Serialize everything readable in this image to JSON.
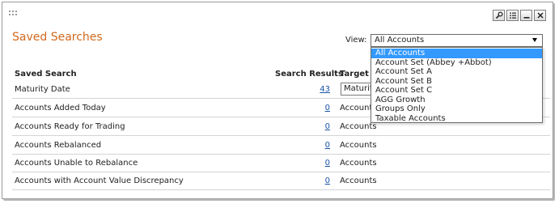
{
  "panel": {
    "title": "Saved Searches"
  },
  "toolbar": {
    "icons": [
      "wrench-icon",
      "list-settings-icon",
      "minimize-icon",
      "close-icon"
    ]
  },
  "view": {
    "label": "View:",
    "selected": "All Accounts",
    "options": [
      "All Accounts",
      "Account Set (Abbey +Abbot)",
      "Account Set A",
      "Account Set B",
      "Account Set C",
      "AGG Growth",
      "Groups Only",
      "Taxable Accounts"
    ]
  },
  "columns": {
    "saved_search": "Saved Search",
    "search_results": "Search Results",
    "target": "Target P"
  },
  "rows": [
    {
      "name": "Maturity Date",
      "count": "43",
      "target": "Maturit"
    },
    {
      "name": "Accounts Added Today",
      "count": "0",
      "target": "Accounts"
    },
    {
      "name": "Accounts Ready for Trading",
      "count": "0",
      "target": "Accounts"
    },
    {
      "name": "Accounts Rebalanced",
      "count": "0",
      "target": "Accounts"
    },
    {
      "name": "Accounts Unable to Rebalance",
      "count": "0",
      "target": "Accounts"
    },
    {
      "name": "Accounts with Account Value Discrepancy",
      "count": "0",
      "target": "Accounts"
    }
  ],
  "colors": {
    "title": "#d2691e",
    "link": "#1a54a8",
    "highlight": "#3399ff"
  }
}
